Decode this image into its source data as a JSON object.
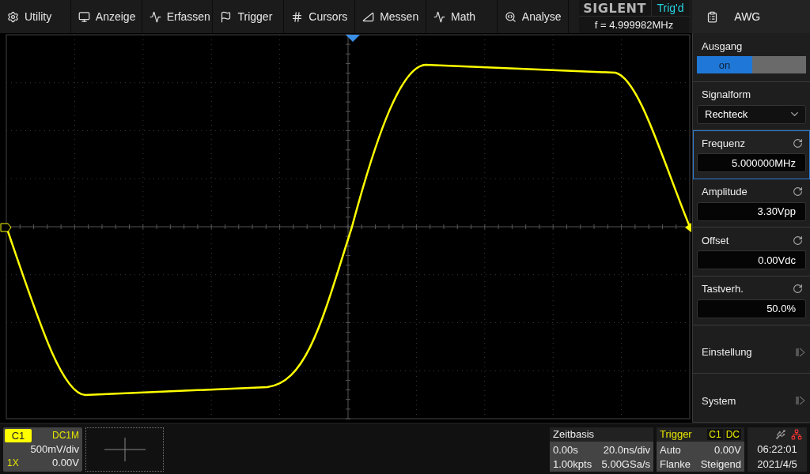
{
  "menu": [
    {
      "label": "Utility"
    },
    {
      "label": "Anzeige"
    },
    {
      "label": "Erfassen"
    },
    {
      "label": "Trigger"
    },
    {
      "label": "Cursors"
    },
    {
      "label": "Messen"
    },
    {
      "label": "Math"
    },
    {
      "label": "Analyse"
    }
  ],
  "brand": {
    "logo": "SIGLENT",
    "trigger_status": "Trig'd",
    "frequency": "f = 4.999982MHz"
  },
  "panel": {
    "title": "AWG",
    "items": [
      {
        "kind": "toggle",
        "label": "Ausgang",
        "value": "on",
        "on": true,
        "selected": false
      },
      {
        "kind": "dropdown",
        "label": "Signalform",
        "value": "Rechteck",
        "selected": false
      },
      {
        "kind": "field",
        "label": "Frequenz",
        "value": "5.000000MHz",
        "selected": true
      },
      {
        "kind": "field",
        "label": "Amplitude",
        "value": "3.30Vpp",
        "selected": false
      },
      {
        "kind": "field",
        "label": "Offset",
        "value": "0.00Vdc",
        "selected": false
      },
      {
        "kind": "field",
        "label": "Tastverh.",
        "value": "50.0%",
        "selected": false
      },
      {
        "kind": "submenu",
        "label": "Einstellung",
        "selected": false
      },
      {
        "kind": "submenu",
        "label": "System",
        "selected": false
      }
    ]
  },
  "channel": {
    "name": "C1",
    "coupling": "DC1M",
    "scale": "500mV/div",
    "probe": "1X",
    "offset": "0.00V"
  },
  "timebase": {
    "title": "Zeitbasis",
    "delay": "0.00s",
    "scale": "20.0ns/div",
    "memory": "1.00kpts",
    "sample_rate": "5.00GSa/s"
  },
  "trigger": {
    "title": "Trigger",
    "source": "C1",
    "coupling": "DC",
    "mode": "Auto",
    "trigger_level": "0.00V",
    "type": "Flanke",
    "slope": "Steigend"
  },
  "status": {
    "time": "06:22:01",
    "date": "2021/4/5"
  }
}
